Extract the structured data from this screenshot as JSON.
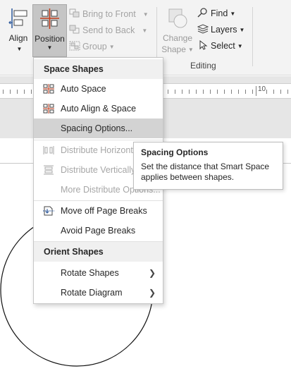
{
  "ribbon": {
    "align_label": "Align",
    "position_label": "Position",
    "bring_to_front": "Bring to Front",
    "send_to_back": "Send to Back",
    "group": "Group",
    "change_shape_line1": "Change",
    "change_shape_line2": "Shape",
    "find": "Find",
    "layers": "Layers",
    "select": "Select",
    "editing_group": "Editing"
  },
  "ruler": {
    "visible_number": "10"
  },
  "menu": {
    "section_space": "Space Shapes",
    "auto_space": "Auto Space",
    "auto_align_space": "Auto Align & Space",
    "spacing_options": "Spacing Options...",
    "distribute_horizontally": "Distribute Horizontally",
    "distribute_vertically": "Distribute Vertically",
    "more_distribute": "More Distribute Options...",
    "move_off_page_breaks": "Move off Page Breaks",
    "avoid_page_breaks": "Avoid Page Breaks",
    "section_orient": "Orient Shapes",
    "rotate_shapes": "Rotate Shapes",
    "rotate_diagram": "Rotate Diagram"
  },
  "tooltip": {
    "title": "Spacing Options",
    "body": "Set the distance that Smart Space applies between shapes."
  },
  "colors": {
    "ribbon_bg": "#f3f3f3",
    "position_pressed": "#c5c5c5",
    "menu_highlight": "#d3d3d3",
    "accent_red": "#c43e1c",
    "accent_blue": "#2b579a"
  }
}
